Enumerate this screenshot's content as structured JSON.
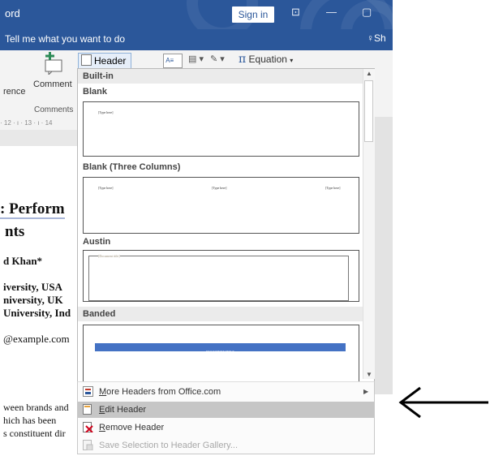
{
  "titlebar": {
    "app_title": "ord",
    "sign_in": "Sign in",
    "restore_glyph": "⊡",
    "minimize_glyph": "—",
    "maximize_glyph": "▢"
  },
  "tellme": {
    "text": "Tell me what you want to do",
    "share": "Sh"
  },
  "ribbon": {
    "reference_fragment": "rence",
    "comment_label": "Comment",
    "comments_group": "Comments",
    "header_label": "Header",
    "equation_label": "Equation",
    "pi_glyph": "π",
    "ruler_text": "· 12 · ı · 13 · ı · 14"
  },
  "document": {
    "title_line1": ": Perform",
    "title_line2": "nts",
    "author": "d Khan*",
    "aff1": "iversity, USA",
    "aff2": "niversity, UK",
    "aff3": "University, Ind",
    "email": "@example.com",
    "body1": "ween brands and",
    "body2": "hich has been",
    "body3": "s constituent dir"
  },
  "gallery": {
    "builtin": "Built-in",
    "sections": [
      {
        "title": "Blank",
        "placeholders": [
          "[Type here]"
        ]
      },
      {
        "title": "Blank (Three Columns)",
        "placeholders": [
          "[Type here]",
          "[Type here]",
          "[Type here]"
        ]
      },
      {
        "title": "Austin",
        "placeholders": [
          "[Document title]"
        ]
      },
      {
        "title": "Banded",
        "placeholders": [
          "DOCUMENT TITLE"
        ]
      }
    ]
  },
  "menu": {
    "items": [
      {
        "label": "More Headers from Office.com",
        "icon": "office-icon",
        "accel": "M",
        "rest": "ore Headers from Office.com",
        "enabled": true
      },
      {
        "label": "Edit Header",
        "icon": "edit-header-icon",
        "accel": "E",
        "rest": "dit Header",
        "enabled": true,
        "highlighted": true
      },
      {
        "label": "Remove Header",
        "icon": "remove-header-icon",
        "accel": "R",
        "rest": "emove Header",
        "enabled": true
      },
      {
        "label": "Save Selection to Header Gallery...",
        "icon": "save-gallery-icon",
        "accel": "",
        "rest": "Save Selection to Header Gallery...",
        "enabled": false
      }
    ]
  },
  "colors": {
    "title_bar": "#2b579a",
    "highlight": "#c6c6c6",
    "banded": "#4472c4"
  }
}
